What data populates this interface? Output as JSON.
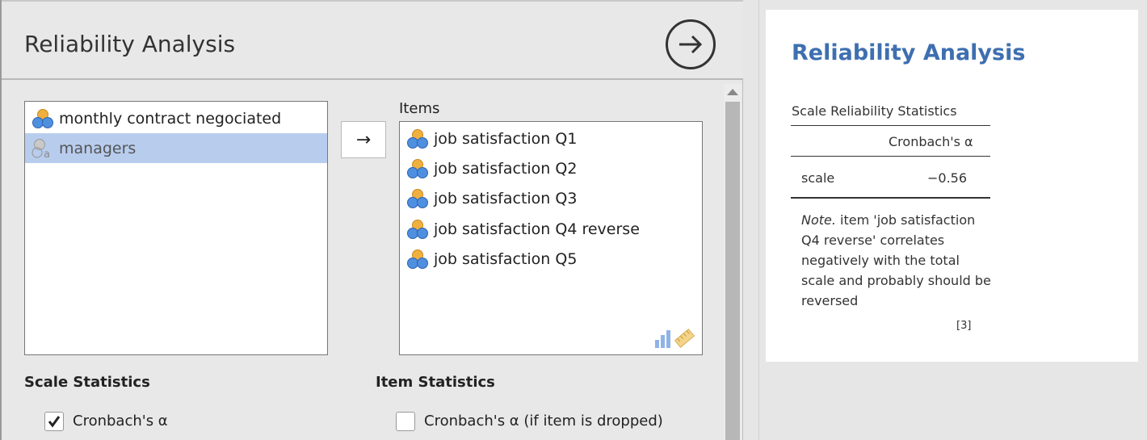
{
  "analysis": {
    "title": "Reliability Analysis"
  },
  "variables": [
    {
      "label": "monthly contract negociated",
      "icon": "continuous-variable-icon",
      "selected": false
    },
    {
      "label": "managers",
      "icon": "nominal-text-variable-icon",
      "selected": true
    }
  ],
  "items_box": {
    "label": "Items",
    "items": [
      {
        "label": "job satisfaction Q1"
      },
      {
        "label": "job satisfaction Q2"
      },
      {
        "label": "job satisfaction Q3"
      },
      {
        "label": "job satisfaction Q4 reverse"
      },
      {
        "label": "job satisfaction Q5"
      }
    ]
  },
  "move_button": {
    "glyph": "→"
  },
  "scale_statistics": {
    "title": "Scale Statistics",
    "cronbach": {
      "label": "Cronbach's α",
      "checked": true
    }
  },
  "item_statistics": {
    "title": "Item Statistics",
    "cronbach_dropped": {
      "label": "Cronbach's α (if item is dropped)",
      "checked": false
    }
  },
  "results": {
    "title": "Reliability Analysis",
    "table_title": "Scale Reliability Statistics",
    "column_header": "Cronbach's α",
    "row_label": "scale",
    "row_value": "−0.56",
    "note_label": "Note.",
    "note_text": " item 'job satisfaction Q4 reverse' correlates negatively with the total scale and probably should be reversed",
    "reference": "[3]"
  },
  "colors": {
    "accent": "#3e6fb0",
    "selection": "#b8cdee",
    "variable_orange": "#f0b040",
    "variable_blue": "#4f8fe0"
  }
}
